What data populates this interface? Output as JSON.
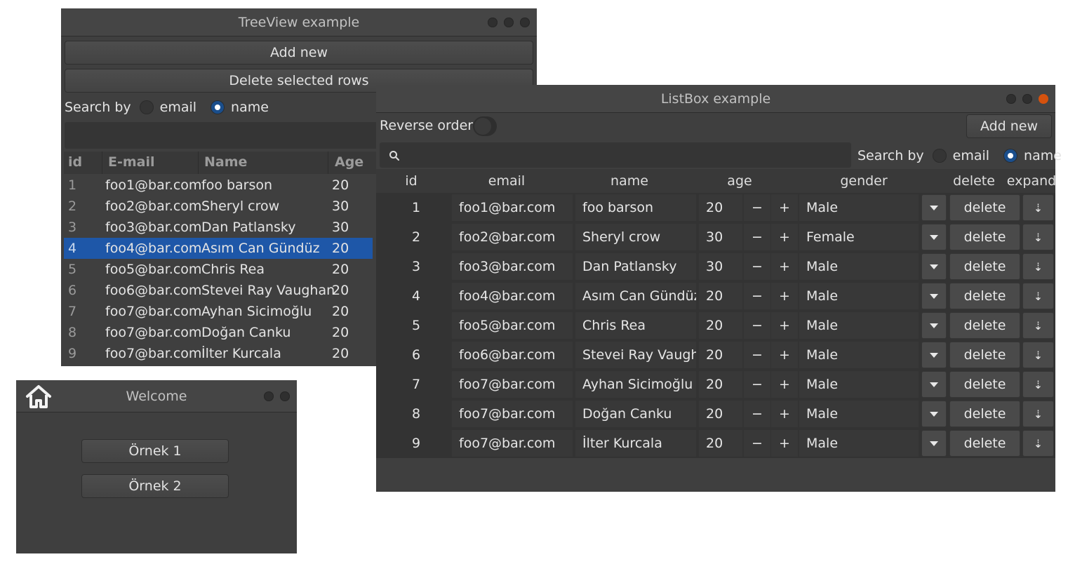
{
  "tree_window": {
    "title": "TreeView example",
    "add_new": "Add new",
    "delete_selected": "Delete selected rows",
    "search_by": "Search by",
    "opt_email": "email",
    "opt_name": "name",
    "selected_option": "name",
    "columns": [
      "id",
      "E-mail",
      "Name",
      "Age"
    ],
    "rows": [
      {
        "id": "1",
        "email": "foo1@bar.com",
        "name": "foo barson",
        "age": "20"
      },
      {
        "id": "2",
        "email": "foo2@bar.com",
        "name": "Sheryl crow",
        "age": "30"
      },
      {
        "id": "3",
        "email": "foo3@bar.com",
        "name": "Dan Patlansky",
        "age": "30"
      },
      {
        "id": "4",
        "email": "foo4@bar.com",
        "name": "Asım Can Gündüz",
        "age": "20",
        "selected": true
      },
      {
        "id": "5",
        "email": "foo5@bar.com",
        "name": "Chris Rea",
        "age": "20"
      },
      {
        "id": "6",
        "email": "foo6@bar.com",
        "name": "Stevei Ray Vaughan",
        "age": "20"
      },
      {
        "id": "7",
        "email": "foo7@bar.com",
        "name": "Ayhan Sicimoğlu",
        "age": "20"
      },
      {
        "id": "8",
        "email": "foo7@bar.com",
        "name": "Doğan Canku",
        "age": "20"
      },
      {
        "id": "9",
        "email": "foo7@bar.com",
        "name": "İlter Kurcala",
        "age": "20"
      }
    ]
  },
  "list_window": {
    "title": "ListBox example",
    "reverse_order": "Reverse order",
    "add_new": "Add new",
    "search_by": "Search by",
    "opt_email": "email",
    "opt_name": "name",
    "selected_option": "name",
    "columns": [
      "id",
      "email",
      "name",
      "age",
      "gender",
      "delete",
      "expand"
    ],
    "minus": "−",
    "plus": "+",
    "delete_label": "delete",
    "expand_glyph": "⇣",
    "rows": [
      {
        "id": "1",
        "email": "foo1@bar.com",
        "name": "foo barson",
        "age": "20",
        "gender": "Male"
      },
      {
        "id": "2",
        "email": "foo2@bar.com",
        "name": "Sheryl crow",
        "age": "30",
        "gender": "Female"
      },
      {
        "id": "3",
        "email": "foo3@bar.com",
        "name": "Dan Patlansky",
        "age": "30",
        "gender": "Male"
      },
      {
        "id": "4",
        "email": "foo4@bar.com",
        "name": "Asım Can Gündüz",
        "age": "20",
        "gender": "Male"
      },
      {
        "id": "5",
        "email": "foo5@bar.com",
        "name": "Chris Rea",
        "age": "20",
        "gender": "Male"
      },
      {
        "id": "6",
        "email": "foo6@bar.com",
        "name": "Stevei Ray Vaughan",
        "age": "20",
        "gender": "Male"
      },
      {
        "id": "7",
        "email": "foo7@bar.com",
        "name": "Ayhan Sicimoğlu",
        "age": "20",
        "gender": "Male"
      },
      {
        "id": "8",
        "email": "foo7@bar.com",
        "name": "Doğan Canku",
        "age": "20",
        "gender": "Male"
      },
      {
        "id": "9",
        "email": "foo7@bar.com",
        "name": "İlter Kurcala",
        "age": "20",
        "gender": "Male"
      }
    ]
  },
  "welcome_window": {
    "title": "Welcome",
    "home_icon": "home-icon",
    "button1": "Örnek 1",
    "button2": "Örnek 2"
  },
  "colors": {
    "window_bg": "#3f3f3f",
    "selection": "#1e57a8",
    "close_dot": "#d5520e"
  }
}
